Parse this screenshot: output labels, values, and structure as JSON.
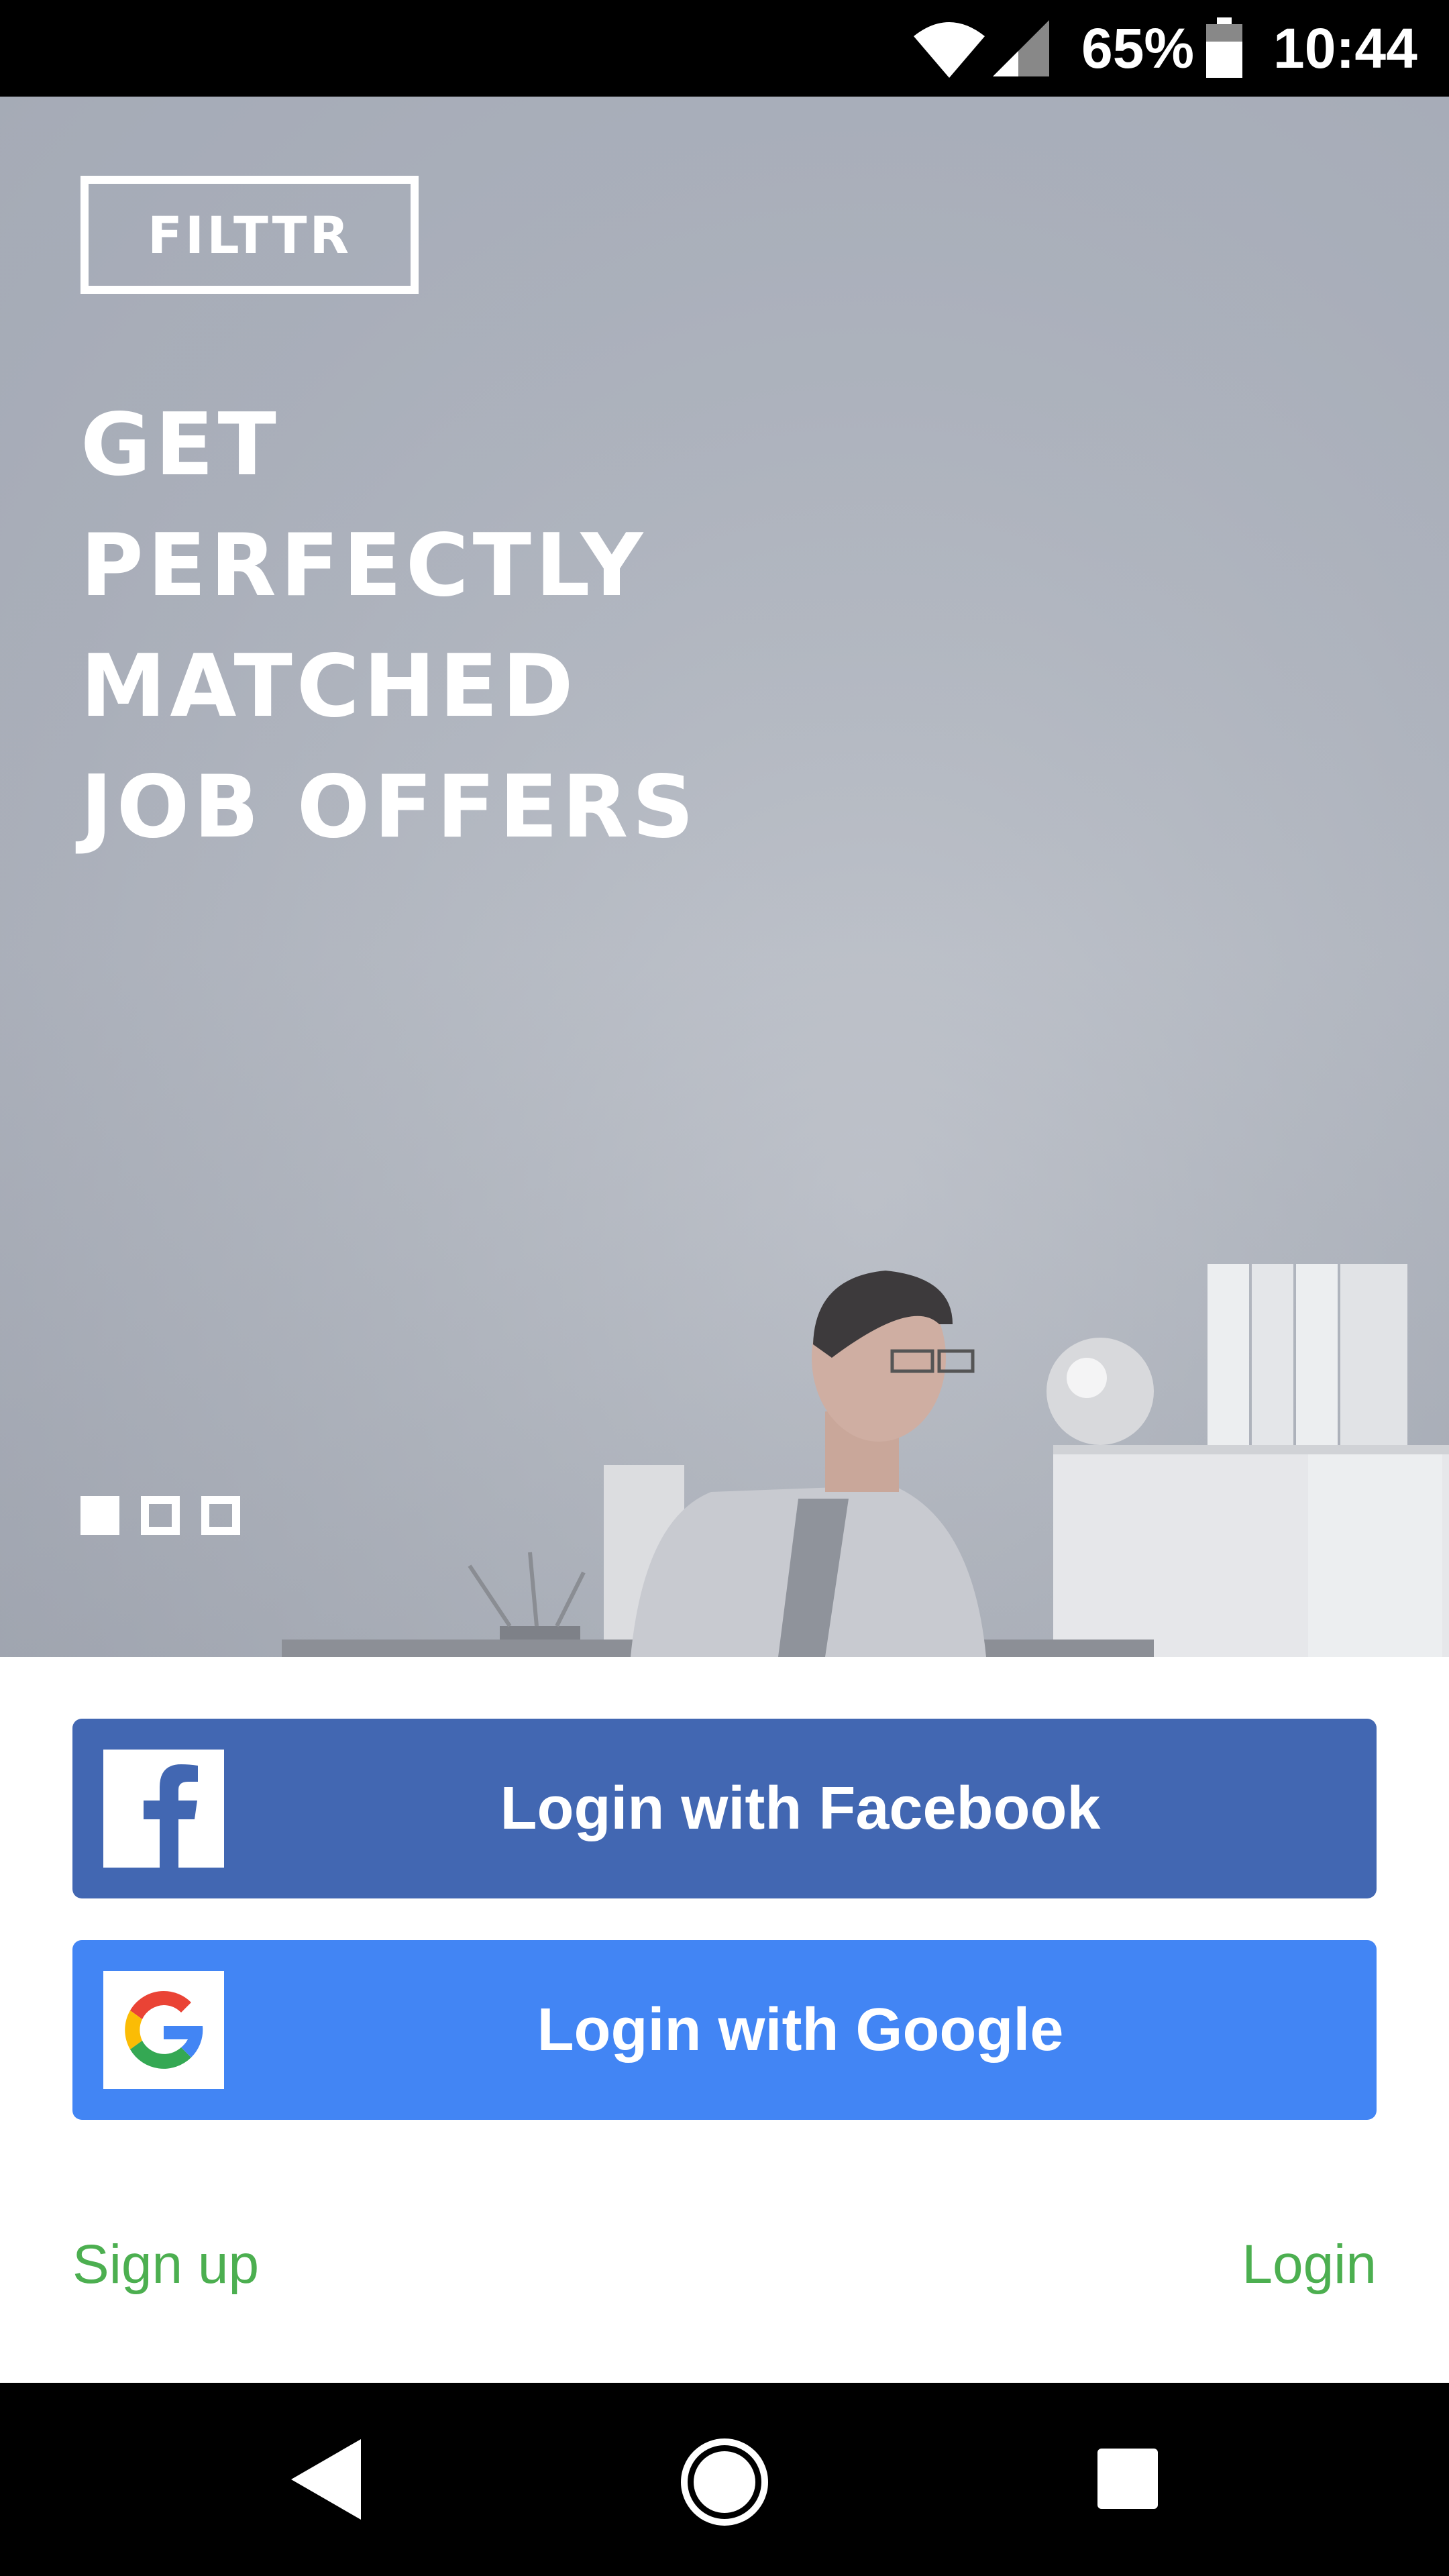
{
  "status_bar": {
    "battery_percent": "65%",
    "time": "10:44",
    "icons": [
      "wifi-icon",
      "cell-signal-icon",
      "battery-icon"
    ]
  },
  "hero": {
    "brand": "FILTTR",
    "headline": [
      "GET",
      "PERFECTLY",
      "MATCHED",
      "JOB OFFERS"
    ],
    "pager": {
      "count": 3,
      "active_index": 0
    }
  },
  "auth": {
    "facebook_label": "Login with Facebook",
    "google_label": "Login with Google",
    "signup_label": "Sign up",
    "login_label": "Login"
  },
  "colors": {
    "facebook": "#4267b2",
    "google": "#4285f4",
    "link_green": "#4caf50"
  },
  "nav_bar": {
    "icons": [
      "back-icon",
      "home-icon",
      "recent-apps-icon"
    ]
  }
}
